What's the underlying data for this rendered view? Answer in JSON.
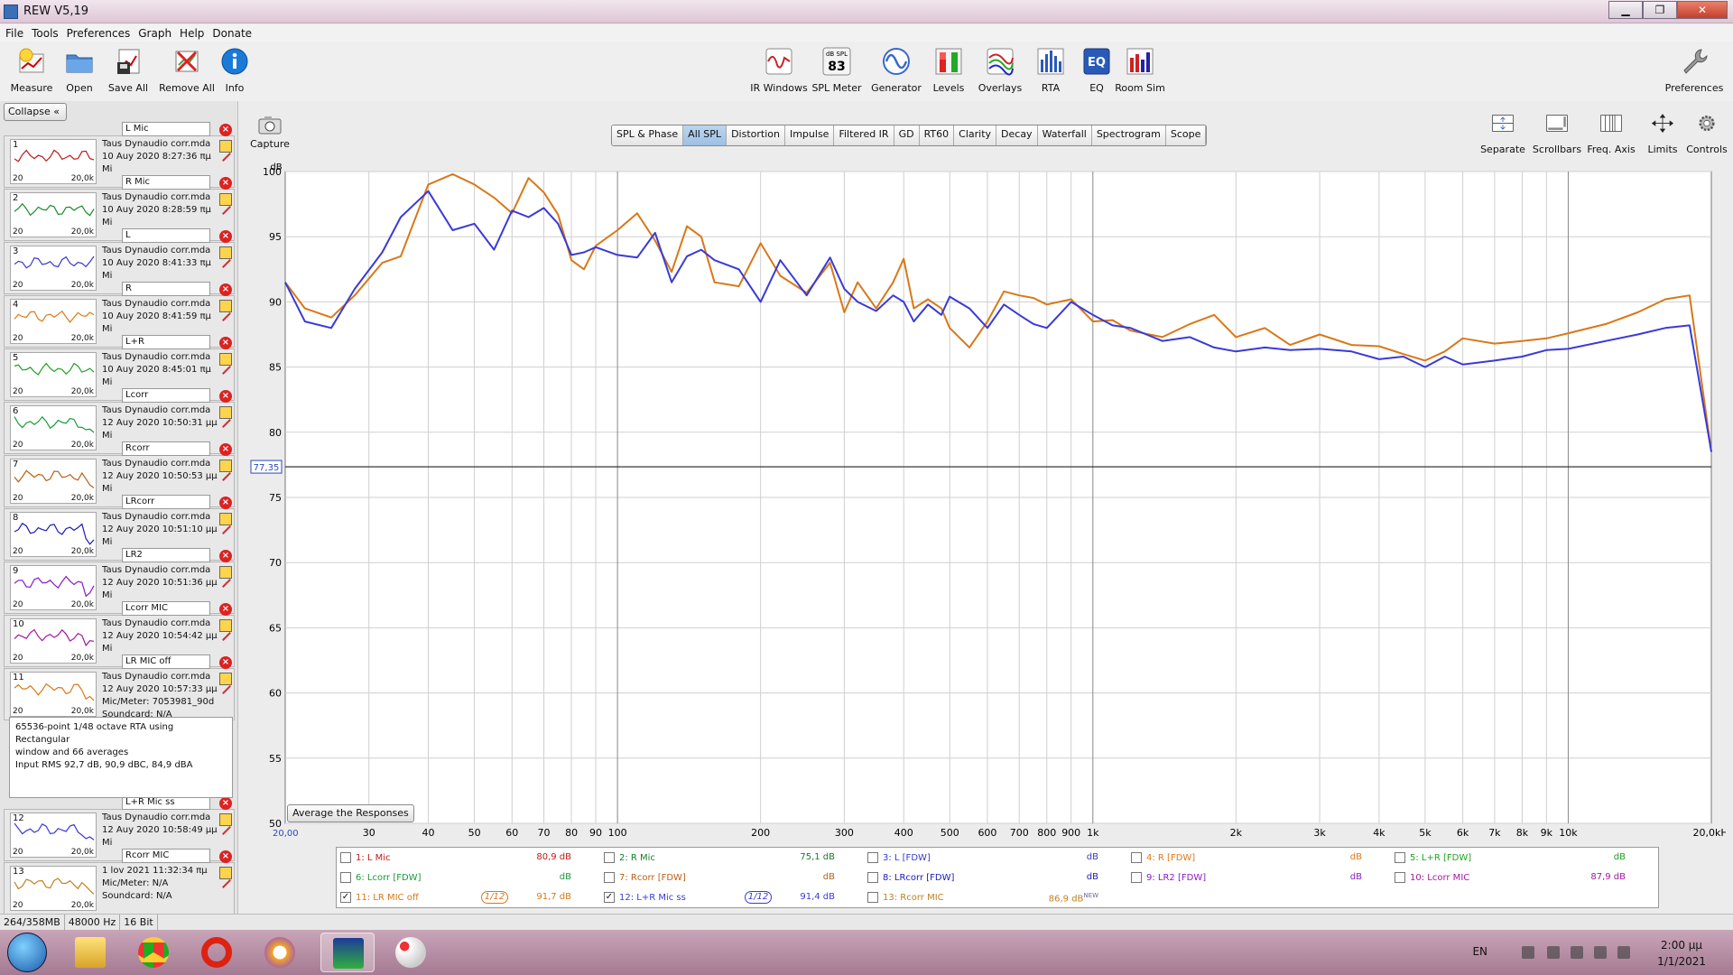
{
  "window": {
    "title": "REW V5,19"
  },
  "menu": [
    "File",
    "Tools",
    "Preferences",
    "Graph",
    "Help",
    "Donate"
  ],
  "toolbar_left": [
    {
      "label": "Measure",
      "icon": "measure-icon"
    },
    {
      "label": "Open",
      "icon": "folder-icon"
    },
    {
      "label": "Save All",
      "icon": "save-icon"
    },
    {
      "label": "Remove All",
      "icon": "remove-icon"
    },
    {
      "label": "Info",
      "icon": "info-icon"
    }
  ],
  "toolbar_center": [
    {
      "label": "IR Windows",
      "icon": "ir-windows-icon"
    },
    {
      "label": "SPL Meter",
      "icon": "spl-meter-icon",
      "badge_top": "dB SPL",
      "badge_value": "83"
    },
    {
      "label": "Generator",
      "icon": "generator-icon"
    },
    {
      "label": "Levels",
      "icon": "levels-icon"
    },
    {
      "label": "Overlays",
      "icon": "overlays-icon"
    },
    {
      "label": "RTA",
      "icon": "rta-icon"
    },
    {
      "label": "EQ",
      "icon": "eq-icon",
      "badge_value": "EQ"
    },
    {
      "label": "Room Sim",
      "icon": "room-sim-icon"
    }
  ],
  "toolbar_right": {
    "label": "Preferences",
    "icon": "wrench-icon"
  },
  "graph_tools": {
    "capture": "Capture",
    "items": [
      "Separate",
      "Scrollbars",
      "Freq. Axis",
      "Limits",
      "Controls"
    ]
  },
  "tabs": [
    "SPL & Phase",
    "All SPL",
    "Distortion",
    "Impulse",
    "Filtered IR",
    "GD",
    "RT60",
    "Clarity",
    "Decay",
    "Waterfall",
    "Spectrogram",
    "Scope"
  ],
  "active_tab": "All SPL",
  "left_panel": {
    "collapse_label": "Collapse",
    "measurements": [
      {
        "num": "1",
        "name": "L Mic",
        "file": "Taus Dynaudio corr.mda",
        "date": "10 Auy 2020 8:27:36 πμ",
        "extra": "Mi",
        "color": "#c01818"
      },
      {
        "num": "2",
        "name": "R Mic",
        "file": "Taus Dynaudio corr.mda",
        "date": "10 Auy 2020 8:28:59 πμ",
        "extra": "Mi",
        "color": "#1a8a2a"
      },
      {
        "num": "3",
        "name": "L",
        "file": "Taus Dynaudio corr.mda",
        "date": "10 Auy 2020 8:41:33 πμ",
        "extra": "Mi",
        "color": "#3a3ac8"
      },
      {
        "num": "4",
        "name": "R",
        "file": "Taus Dynaudio corr.mda",
        "date": "10 Auy 2020 8:41:59 πμ",
        "extra": "Mi",
        "color": "#e07818"
      },
      {
        "num": "5",
        "name": "L+R",
        "file": "Taus Dynaudio corr.mda",
        "date": "10 Auy 2020 8:45:01 πμ",
        "extra": "Mi",
        "color": "#22a022"
      },
      {
        "num": "6",
        "name": "Lcorr",
        "file": "Taus Dynaudio corr.mda",
        "date": "12 Auy 2020 10:50:31 μμ",
        "extra": "Mi",
        "color": "#1a9a3a"
      },
      {
        "num": "7",
        "name": "Rcorr",
        "file": "Taus Dynaudio corr.mda",
        "date": "12 Auy 2020 10:50:53 μμ",
        "extra": "Mi",
        "color": "#b86018"
      },
      {
        "num": "8",
        "name": "LRcorr",
        "file": "Taus Dynaudio corr.mda",
        "date": "12 Auy 2020 10:51:10 μμ",
        "extra": "Mi",
        "color": "#1a1ab8"
      },
      {
        "num": "9",
        "name": "LR2",
        "file": "Taus Dynaudio corr.mda",
        "date": "12 Auy 2020 10:51:36 μμ",
        "extra": "Mi",
        "color": "#8a1ac8"
      },
      {
        "num": "10",
        "name": "Lcorr  MIC",
        "file": "Taus Dynaudio corr.mda",
        "date": "12 Auy 2020 10:54:42 μμ",
        "extra": "Mi",
        "color": "#a018a0"
      },
      {
        "num": "11",
        "name": "LR MIC off",
        "file": "Taus Dynaudio corr.mda",
        "date": "12 Auy 2020 10:57:33 μμ",
        "extra": "Mic/Meter: 7053981_90d",
        "extra2": "Soundcard: N/A",
        "color": "#d87818"
      },
      {
        "num": "12",
        "name": "L+R Mic ss",
        "file": "Taus Dynaudio corr.mda",
        "date": "12 Auy 2020 10:58:49 μμ",
        "extra": "Mi",
        "color": "#3a3ad8"
      },
      {
        "num": "13",
        "name": "Rcorr MIC",
        "file": "1 lov 2021 11:32:34 πμ",
        "date": "Mic/Meter: N/A",
        "extra": "Soundcard: N/A",
        "color": "#c08020"
      }
    ],
    "thumb_lo": "20",
    "thumb_hi": "20,0k",
    "info_lines": [
      "65536-point 1/48 octave RTA using Rectangular",
      "window and 66 averages",
      "Input RMS 92,7 dB, 90,9 dBC, 84,9 dBA"
    ]
  },
  "average_button": "Average the Responses",
  "legend": [
    {
      "label": "1: L Mic",
      "value": "80,9 dB",
      "color": "#c01818",
      "checked": false
    },
    {
      "label": "2: R Mic",
      "value": "75,1 dB",
      "color": "#1a7a2a",
      "checked": false
    },
    {
      "label": "3: L [FDW]",
      "value": "dB",
      "color": "#3a3ac8",
      "checked": false
    },
    {
      "label": "4: R [FDW]",
      "value": "dB",
      "color": "#e07818",
      "checked": false
    },
    {
      "label": "5: L+R [FDW]",
      "value": "dB",
      "color": "#22a022",
      "checked": false
    },
    {
      "label": "6: Lcorr [FDW]",
      "value": "dB",
      "color": "#1a9a3a",
      "checked": false
    },
    {
      "label": "7: Rcorr [FDW]",
      "value": "dB",
      "color": "#b86018",
      "checked": false
    },
    {
      "label": "8: LRcorr [FDW]",
      "value": "dB",
      "color": "#1a1ab8",
      "checked": false
    },
    {
      "label": "9: LR2 [FDW]",
      "value": "dB",
      "color": "#8a1ac8",
      "checked": false
    },
    {
      "label": "10: Lcorr  MIC",
      "value": "87,9 dB",
      "color": "#a018a0",
      "checked": false
    },
    {
      "label": "11: LR MIC off",
      "value": "91,7 dB",
      "color": "#d87818",
      "checked": true,
      "smoothing": "1/12"
    },
    {
      "label": "12: L+R Mic ss",
      "value": "91,4 dB",
      "color": "#3a3ad8",
      "checked": true,
      "smoothing": "1/12"
    },
    {
      "label": "13: Rcorr MIC",
      "value": "86,9 dB",
      "color": "#c08020",
      "checked": false,
      "badge": "NEW"
    }
  ],
  "status_bar": [
    "264/358MB",
    "48000 Hz",
    "16 Bit"
  ],
  "taskbar": {
    "lang": "EN",
    "time": "2:00 μμ",
    "date": "1/1/2021",
    "apps": [
      "explorer-icon",
      "chrome-icon",
      "opera-icon",
      "browser-icon",
      "rew-icon",
      "paint-icon"
    ]
  },
  "chart_data": {
    "type": "line",
    "ylabel": "dB",
    "ylim": [
      50,
      100
    ],
    "y_ticks": [
      50,
      55,
      60,
      65,
      70,
      75,
      80,
      85,
      90,
      95,
      100
    ],
    "x_scale": "log",
    "xlim": [
      20,
      20000
    ],
    "x_ticks": [
      {
        "v": 30,
        "l": "30"
      },
      {
        "v": 40,
        "l": "40"
      },
      {
        "v": 50,
        "l": "50"
      },
      {
        "v": 60,
        "l": "60"
      },
      {
        "v": 70,
        "l": "70"
      },
      {
        "v": 80,
        "l": "80"
      },
      {
        "v": 90,
        "l": "90"
      },
      {
        "v": 100,
        "l": "100"
      },
      {
        "v": 200,
        "l": "200"
      },
      {
        "v": 300,
        "l": "300"
      },
      {
        "v": 400,
        "l": "400"
      },
      {
        "v": 500,
        "l": "500"
      },
      {
        "v": 600,
        "l": "600"
      },
      {
        "v": 700,
        "l": "700"
      },
      {
        "v": 800,
        "l": "800"
      },
      {
        "v": 900,
        "l": "900"
      },
      {
        "v": 1000,
        "l": "1k"
      },
      {
        "v": 2000,
        "l": "2k"
      },
      {
        "v": 3000,
        "l": "3k"
      },
      {
        "v": 4000,
        "l": "4k"
      },
      {
        "v": 5000,
        "l": "5k"
      },
      {
        "v": 6000,
        "l": "6k"
      },
      {
        "v": 7000,
        "l": "7k"
      },
      {
        "v": 8000,
        "l": "8k"
      },
      {
        "v": 9000,
        "l": "9k"
      },
      {
        "v": 10000,
        "l": "10k"
      }
    ],
    "x_start_label": "20,00",
    "x_end_label": "20,0kHz",
    "ref_level": 77.35,
    "ref_label": "77,35",
    "series": [
      {
        "name": "11: LR MIC off",
        "color": "#d87818",
        "x": [
          20,
          22,
          25,
          28,
          32,
          35,
          40,
          45,
          50,
          55,
          60,
          65,
          70,
          75,
          80,
          85,
          90,
          100,
          110,
          120,
          130,
          140,
          150,
          160,
          180,
          200,
          220,
          250,
          280,
          300,
          320,
          350,
          380,
          400,
          420,
          450,
          480,
          500,
          550,
          600,
          650,
          700,
          750,
          800,
          900,
          1000,
          1100,
          1200,
          1400,
          1600,
          1800,
          2000,
          2300,
          2600,
          3000,
          3500,
          4000,
          4500,
          5000,
          5500,
          6000,
          7000,
          8000,
          9000,
          10000,
          12000,
          14000,
          16000,
          18000,
          20000
        ],
        "y": [
          91.5,
          89.5,
          88.8,
          90.5,
          93,
          93.5,
          99,
          99.8,
          99,
          98,
          96.8,
          99.5,
          98.4,
          96.7,
          93.2,
          92.5,
          94.3,
          95.5,
          96.8,
          94.7,
          92.3,
          95.8,
          95,
          91.5,
          91.2,
          94.5,
          92,
          90.7,
          93,
          89.2,
          91.5,
          89.5,
          91.5,
          93.3,
          89.5,
          90.2,
          89.5,
          88,
          86.5,
          88.5,
          90.8,
          90.5,
          90.3,
          89.8,
          90.2,
          88.5,
          88.6,
          87.8,
          87.3,
          88.3,
          89,
          87.3,
          88,
          86.7,
          87.5,
          86.7,
          86.6,
          86,
          85.5,
          86.2,
          87.2,
          86.8,
          87,
          87.2,
          87.6,
          88.3,
          89.2,
          90.2,
          90.5,
          78.5
        ]
      },
      {
        "name": "12: L+R Mic ss",
        "color": "#3a3ad8",
        "x": [
          20,
          22,
          25,
          28,
          32,
          35,
          40,
          45,
          50,
          55,
          60,
          65,
          70,
          75,
          80,
          85,
          90,
          100,
          110,
          120,
          130,
          140,
          150,
          160,
          180,
          200,
          220,
          250,
          280,
          300,
          320,
          350,
          380,
          400,
          420,
          450,
          480,
          500,
          550,
          600,
          650,
          700,
          750,
          800,
          900,
          1000,
          1100,
          1200,
          1400,
          1600,
          1800,
          2000,
          2300,
          2600,
          3000,
          3500,
          4000,
          4500,
          5000,
          5500,
          6000,
          7000,
          8000,
          9000,
          10000,
          12000,
          14000,
          16000,
          18000,
          20000
        ],
        "y": [
          91.5,
          88.5,
          88,
          91,
          93.8,
          96.5,
          98.5,
          95.5,
          96,
          94,
          97,
          96.5,
          97.2,
          96,
          93.6,
          93.8,
          94.2,
          93.6,
          93.4,
          95.3,
          91.5,
          93.5,
          94,
          93.2,
          92.5,
          90,
          93.2,
          90.5,
          93.4,
          91,
          90,
          89.3,
          90.5,
          90,
          88.5,
          89.8,
          89,
          90.4,
          89.5,
          88,
          89.8,
          89,
          88.3,
          88,
          90,
          89,
          88.2,
          88,
          87,
          87.3,
          86.5,
          86.2,
          86.5,
          86.3,
          86.4,
          86.2,
          85.6,
          85.8,
          85,
          85.8,
          85.2,
          85.5,
          85.8,
          86.3,
          86.4,
          87,
          87.5,
          88,
          88.2,
          78.5
        ]
      }
    ]
  }
}
